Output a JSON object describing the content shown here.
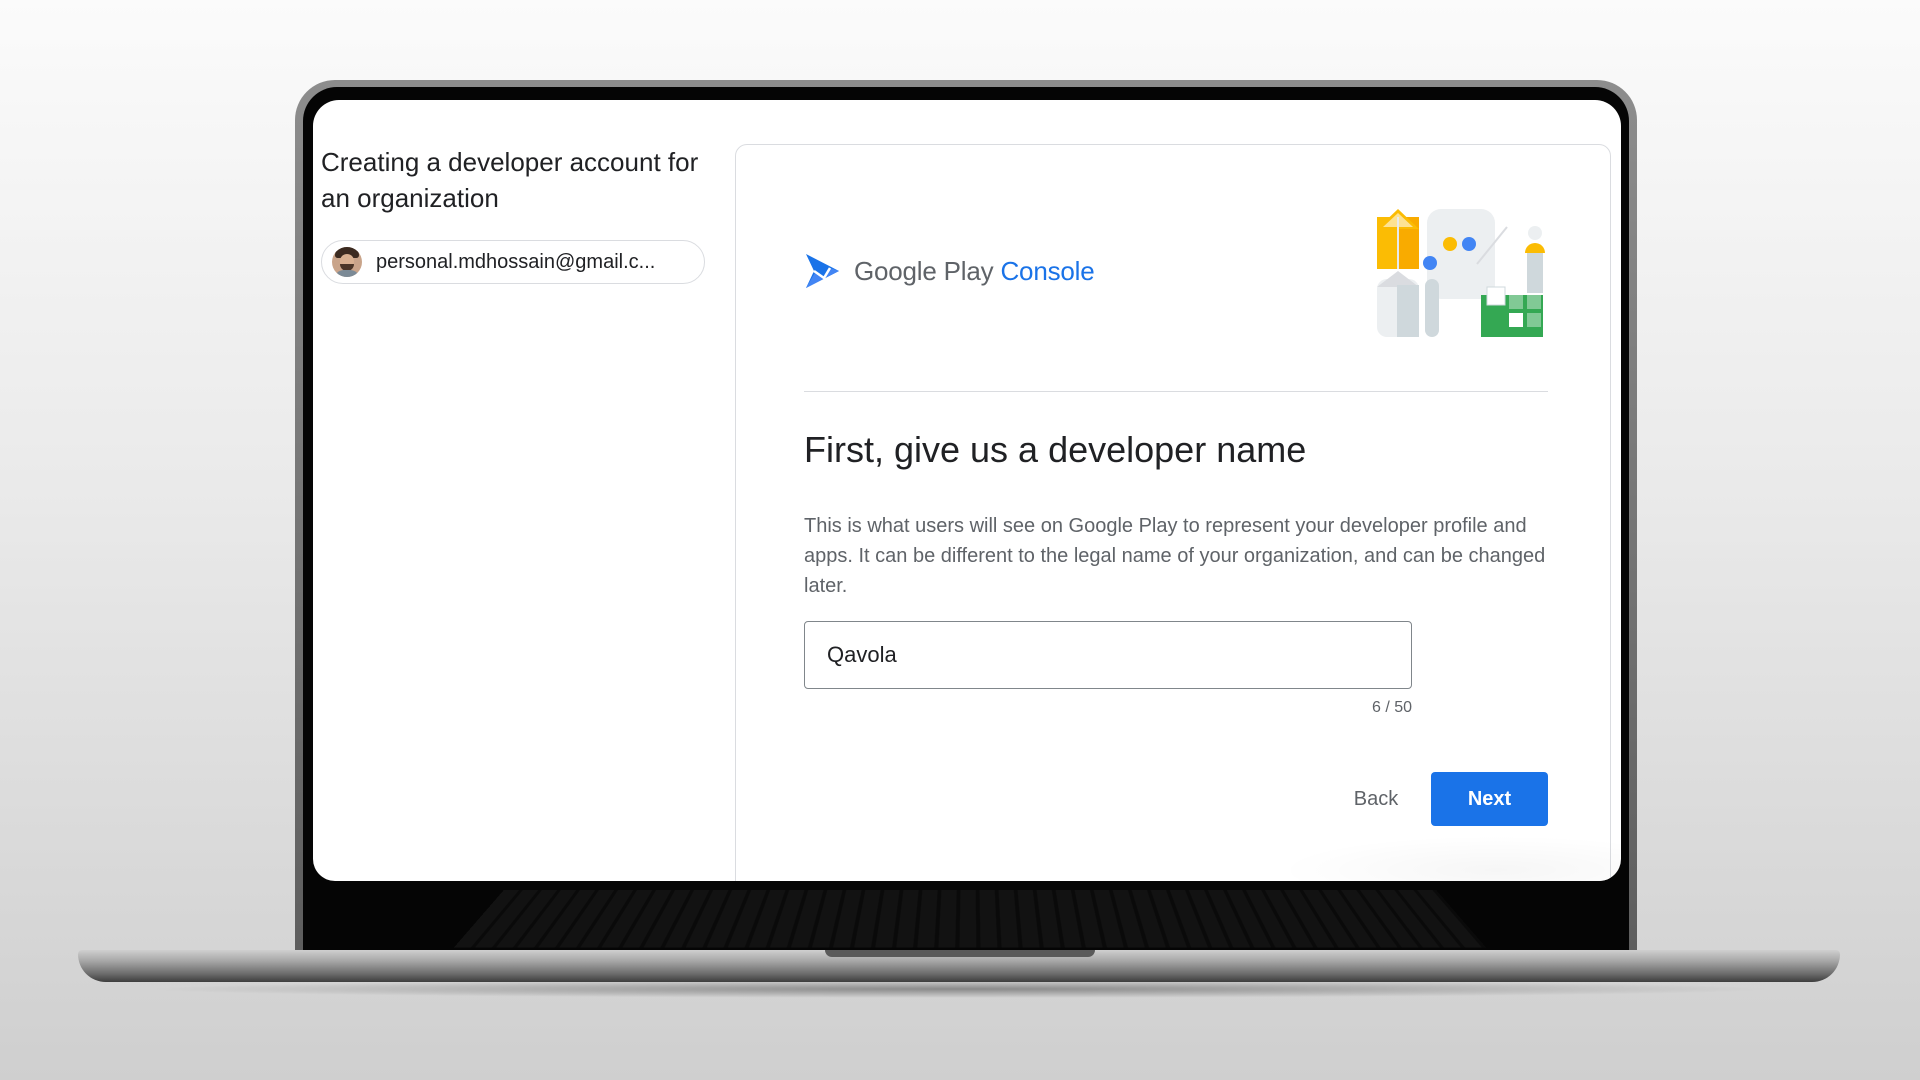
{
  "page": {
    "flow_title": "Creating a developer account for an organization",
    "account_email": "personal.mdhossain@gmail.c..."
  },
  "brand": {
    "company": "Google Play",
    "product": "Console"
  },
  "step": {
    "heading": "First, give us a developer name",
    "description": "This is what users will see on Google Play to represent your developer profile and apps. It can be different to the legal name of your organization, and can be changed later.",
    "field_value": "Qavola",
    "char_count": "6 / 50"
  },
  "actions": {
    "back_label": "Back",
    "next_label": "Next"
  },
  "colors": {
    "accent": "#1a73e8",
    "logo_yellow": "#fbbc04",
    "logo_green": "#34a853",
    "text_primary": "#202124",
    "text_secondary": "#5f6368"
  },
  "icons": {
    "logo": "play-console-logo-icon",
    "avatar": "user-avatar",
    "decorative": "play-illustration-icon"
  }
}
